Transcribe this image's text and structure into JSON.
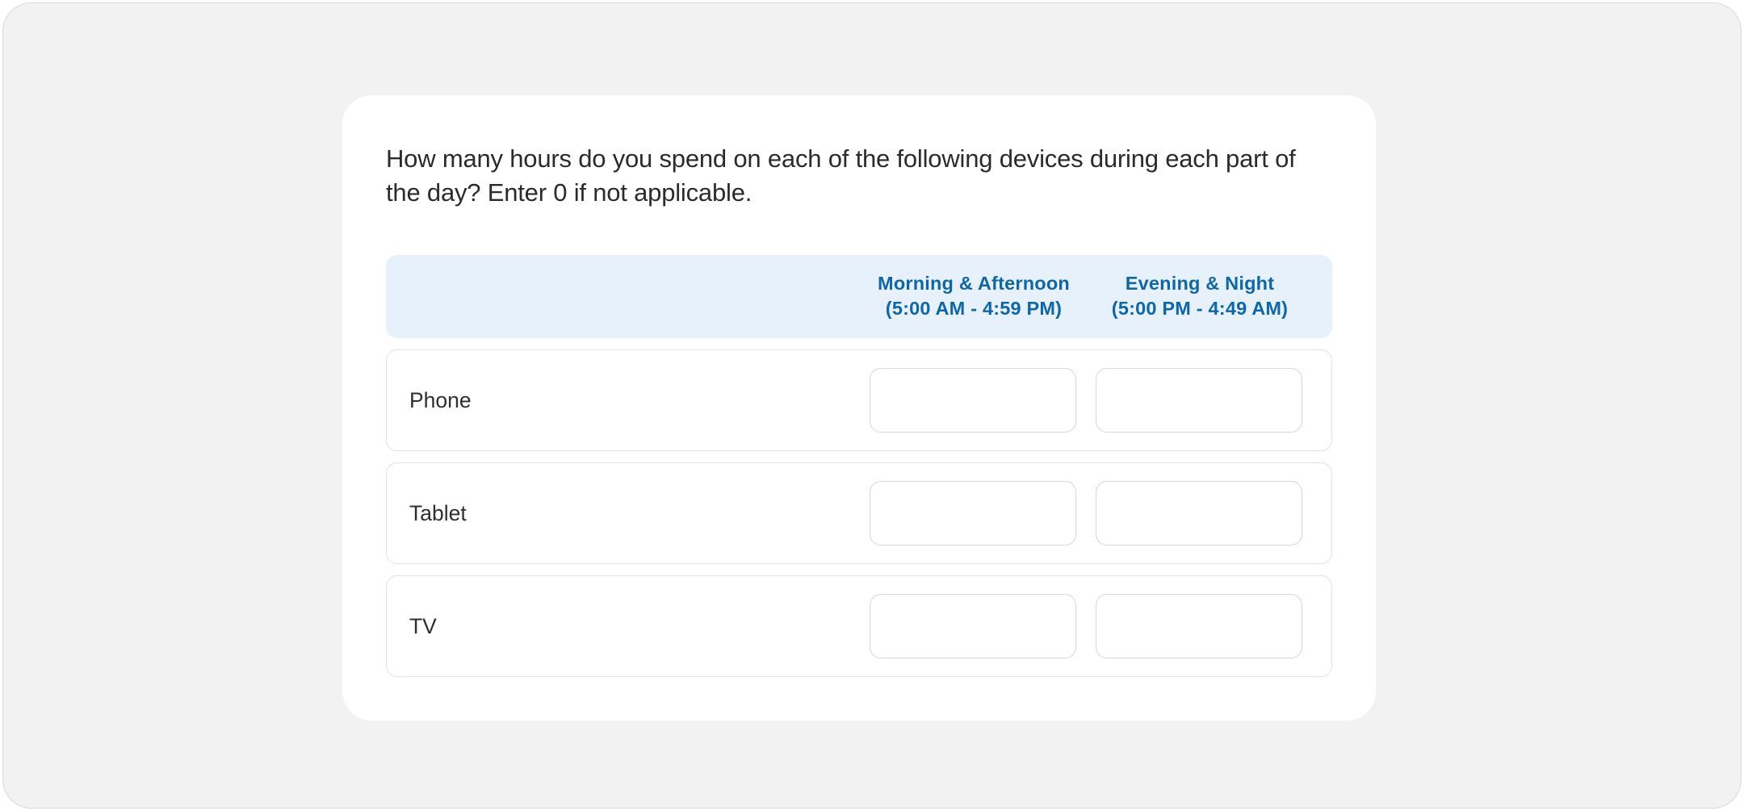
{
  "question": "How many hours do you spend on each of the following devices during each part of the day? Enter 0 if not applicable.",
  "columns": [
    {
      "line1": "Morning & Afternoon",
      "line2": "(5:00 AM - 4:59 PM)"
    },
    {
      "line1": "Evening & Night",
      "line2": "(5:00 PM - 4:49 AM)"
    }
  ],
  "rows": [
    {
      "label": "Phone",
      "values": [
        "",
        ""
      ]
    },
    {
      "label": "Tablet",
      "values": [
        "",
        ""
      ]
    },
    {
      "label": "TV",
      "values": [
        "",
        ""
      ]
    }
  ],
  "colors": {
    "page_bg": "#f2f2f2",
    "card_bg": "#ffffff",
    "header_bg": "#e7f1fb",
    "header_text": "#0e67a6",
    "border": "#e2e2e2",
    "text": "#2b2b2b"
  }
}
